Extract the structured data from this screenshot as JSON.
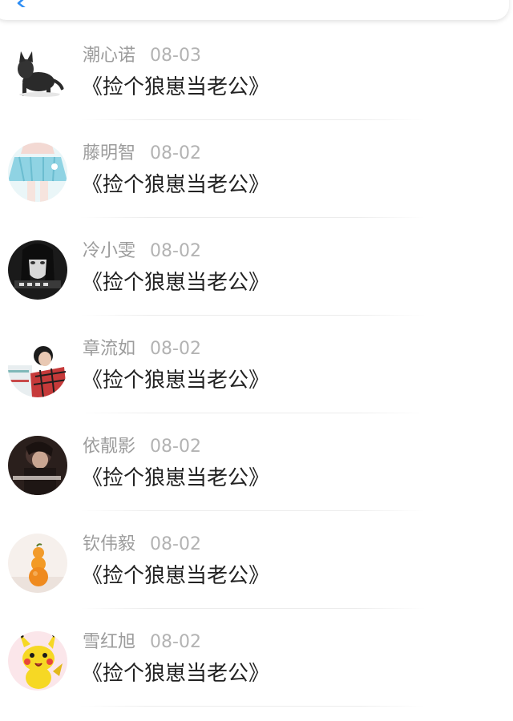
{
  "header": {
    "back_icon": "chevron-left-icon",
    "accent_color": "#2f8ef4"
  },
  "comments": [
    {
      "user": "潮心诺",
      "date": "08-03",
      "text": "《捡个狼崽当老公》",
      "avatar": "black-cat"
    },
    {
      "user": "藤明智",
      "date": "08-02",
      "text": "《捡个狼崽当老公》",
      "avatar": "blue-skirt"
    },
    {
      "user": "冷小雯",
      "date": "08-02",
      "text": "《捡个狼崽当老公》",
      "avatar": "bw-girl"
    },
    {
      "user": "章流如",
      "date": "08-02",
      "text": "《捡个狼崽当老公》",
      "avatar": "boy-plaid"
    },
    {
      "user": "依靓影",
      "date": "08-02",
      "text": "《捡个狼崽当老公》",
      "avatar": "dark-photo"
    },
    {
      "user": "钦伟毅",
      "date": "08-02",
      "text": "《捡个狼崽当老公》",
      "avatar": "oranges"
    },
    {
      "user": "雪红旭",
      "date": "08-02",
      "text": "《捡个狼崽当老公》",
      "avatar": "pikachu"
    }
  ]
}
